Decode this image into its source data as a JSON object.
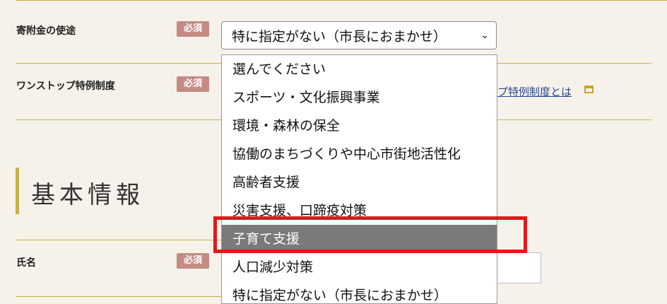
{
  "form": {
    "usage_label": "寄附金の使途",
    "required_badge": "必須",
    "usage_selected": "特に指定がない（市長におまかせ）",
    "onestop_label": "ワンストップ特例制度",
    "onestop_link": "プ特例制度とは",
    "section_title": "基本情報",
    "name_label": "氏名"
  },
  "dropdown": {
    "options": [
      "選んでください",
      "スポーツ・文化振興事業",
      "環境・森林の保全",
      "協働のまちづくりや中心市街地活性化",
      "高齢者支援",
      "災害支援、口蹄疫対策",
      "子育て支援",
      "人口減少対策",
      "特に指定がない（市長におまかせ）"
    ],
    "highlighted_index": 6
  },
  "colors": {
    "accent_line": "#c7b24a",
    "badge": "#c48a84",
    "highlight_border": "#e4181a",
    "selected_option": "#7a7a7a"
  }
}
